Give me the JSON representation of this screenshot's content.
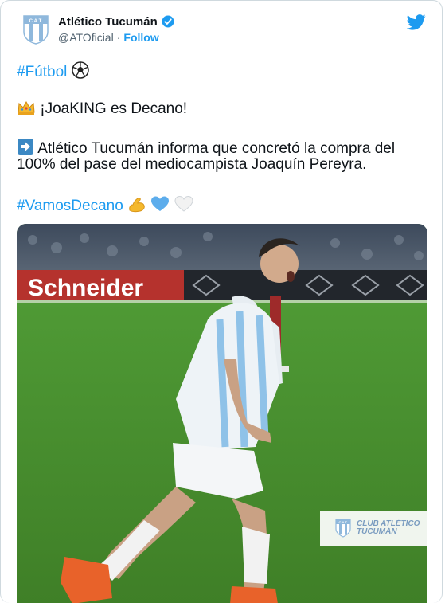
{
  "account": {
    "name": "Atlético Tucumán",
    "handle": "@ATOficial",
    "separator": "·",
    "follow_label": "Follow",
    "avatar_text": "C.A.T."
  },
  "tweet": {
    "hashtag_futbol": "#Fútbol",
    "line_crown": "¡JoaKING es Decano!",
    "line_announce_1": "Atlético Tucumán informa que concretó la compra del",
    "line_announce_2": "100% del pase del mediocampista Joaquín Pereyra.",
    "hashtag_vamos": "#VamosDecano"
  },
  "photo": {
    "banner_text": "Schneider",
    "watermark_line1": "CLUB ATLÉTICO",
    "watermark_line2": "TUCUMÁN",
    "crest_text": "C.A.T."
  },
  "colors": {
    "link": "#1d9bf0",
    "text": "#0f1419",
    "muted": "#536471",
    "verified": "#1d9bf0",
    "banner_red": "#b5322d"
  }
}
